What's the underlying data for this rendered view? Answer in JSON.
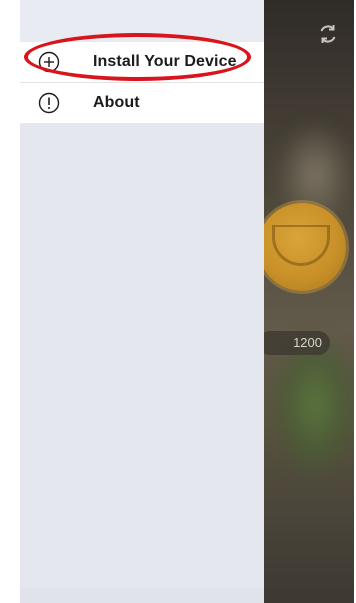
{
  "menu": {
    "items": [
      {
        "label": "Install Your Device",
        "icon": "plus-circle-icon"
      },
      {
        "label": "About",
        "icon": "info-circle-icon"
      }
    ]
  },
  "background": {
    "device_pill_text": "1200",
    "refresh_icon": "refresh-icon"
  },
  "colors": {
    "drawer_background": "#e4e7ee",
    "menu_background": "#ffffff",
    "highlight_ring": "#d8141c",
    "device_gold": "#c99128"
  }
}
